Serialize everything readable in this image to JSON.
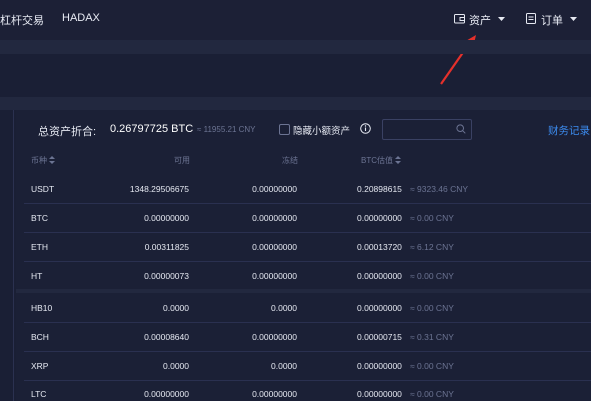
{
  "nav": {
    "item1": "杠杆交易",
    "item2": "HADAX",
    "assets_label": "资产",
    "orders_label": "订单"
  },
  "summary": {
    "total_label": "总资产折合:",
    "btc_value": "0.26797725 BTC",
    "cny_value": "≈ 11955.21 CNY",
    "hide_small_label": "隐藏小额资产",
    "finance_record": "财务记录"
  },
  "table": {
    "headers": [
      "币种",
      "可用",
      "冻结",
      "BTC估值"
    ],
    "rows": [
      {
        "coin": "USDT",
        "available": "1348.29506675",
        "frozen": "0.00000000",
        "btc": "0.20898615",
        "cny": "≈ 9323.46 CNY"
      },
      {
        "coin": "BTC",
        "available": "0.00000000",
        "frozen": "0.00000000",
        "btc": "0.00000000",
        "cny": "≈ 0.00 CNY"
      },
      {
        "coin": "ETH",
        "available": "0.00311825",
        "frozen": "0.00000000",
        "btc": "0.00013720",
        "cny": "≈ 6.12 CNY"
      },
      {
        "coin": "HT",
        "available": "0.00000073",
        "frozen": "0.00000000",
        "btc": "0.00000000",
        "cny": "≈ 0.00 CNY"
      },
      {
        "coin": "HB10",
        "available": "0.0000",
        "frozen": "0.0000",
        "btc": "0.00000000",
        "cny": "≈ 0.00 CNY"
      },
      {
        "coin": "BCH",
        "available": "0.00008640",
        "frozen": "0.00000000",
        "btc": "0.00000715",
        "cny": "≈ 0.31 CNY"
      },
      {
        "coin": "XRP",
        "available": "0.0000",
        "frozen": "0.0000",
        "btc": "0.00000000",
        "cny": "≈ 0.00 CNY"
      },
      {
        "coin": "LTC",
        "available": "0.00000000",
        "frozen": "0.00000000",
        "btc": "0.00000000",
        "cny": "≈ 0.00 CNY"
      }
    ]
  },
  "colors": {
    "accent": "#3c8cf0",
    "annotation_arrow": "#e5302b"
  }
}
